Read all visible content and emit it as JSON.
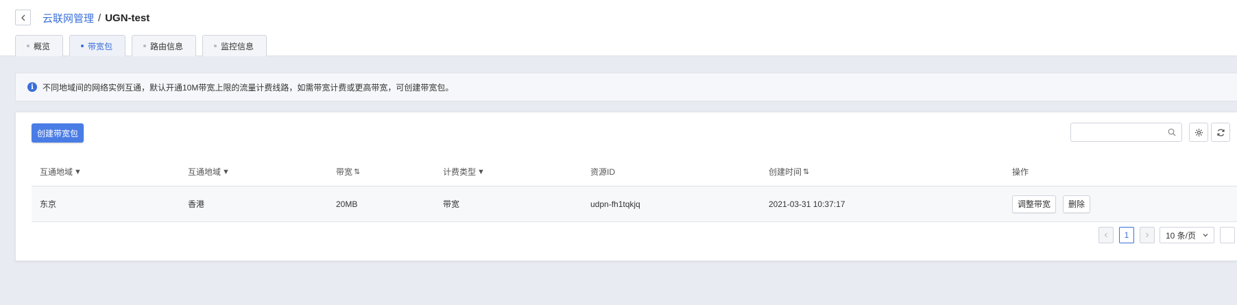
{
  "breadcrumb": {
    "parent": "云联网管理",
    "separator": "/",
    "current": "UGN-test"
  },
  "tabs": [
    {
      "label": "概览",
      "active": false
    },
    {
      "label": "带宽包",
      "active": true
    },
    {
      "label": "路由信息",
      "active": false
    },
    {
      "label": "监控信息",
      "active": false
    }
  ],
  "notice": {
    "text": "不同地域间的网络实例互通，默认开通10M带宽上限的流量计费线路，如需带宽计费或更高带宽，可创建带宽包。"
  },
  "toolbar": {
    "create_label": "创建带宽包",
    "search_placeholder": ""
  },
  "table": {
    "columns": [
      {
        "label": "互通地域",
        "glyph": "▼"
      },
      {
        "label": "互通地域",
        "glyph": "▼"
      },
      {
        "label": "带宽",
        "glyph": "⇅"
      },
      {
        "label": "计费类型",
        "glyph": "▼"
      },
      {
        "label": "资源ID",
        "glyph": ""
      },
      {
        "label": "创建时间",
        "glyph": "⇅"
      },
      {
        "label": "操作",
        "glyph": ""
      }
    ],
    "rows": [
      {
        "region_a": "东京",
        "region_b": "香港",
        "bandwidth": "20MB",
        "charge_type": "带宽",
        "resource_id": "udpn-fh1tqkjq",
        "created_at": "2021-03-31 10:37:17",
        "actions": [
          "调整带宽",
          "删除"
        ]
      }
    ]
  },
  "pagination": {
    "current_page": "1",
    "page_size": "10 条/页"
  },
  "colors": {
    "accent": "#3a6fd8",
    "primary_button": "#4a7ce6",
    "background": "#e9ebf2"
  }
}
